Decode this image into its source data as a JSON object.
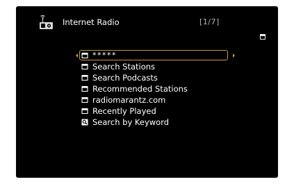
{
  "header": {
    "title": "Internet Radio",
    "page_indicator": "[1/7]",
    "icon": "internet-radio-icon"
  },
  "menu": {
    "selected_index": 0,
    "items": [
      {
        "label": "*****",
        "icon": "folder-icon"
      },
      {
        "label": "Search Stations",
        "icon": "folder-icon"
      },
      {
        "label": "Search Podcasts",
        "icon": "folder-icon"
      },
      {
        "label": "Recommended Stations",
        "icon": "folder-icon"
      },
      {
        "label": "radiomarantz.com",
        "icon": "folder-icon"
      },
      {
        "label": "Recently Played",
        "icon": "folder-icon"
      },
      {
        "label": "Search by Keyword",
        "icon": "search-keyword-icon"
      }
    ]
  },
  "colors": {
    "screen_background": "#000000",
    "text": "#ffffff",
    "highlight_border": "#c79a45",
    "page_indicator_text": "#b7b7b7"
  }
}
